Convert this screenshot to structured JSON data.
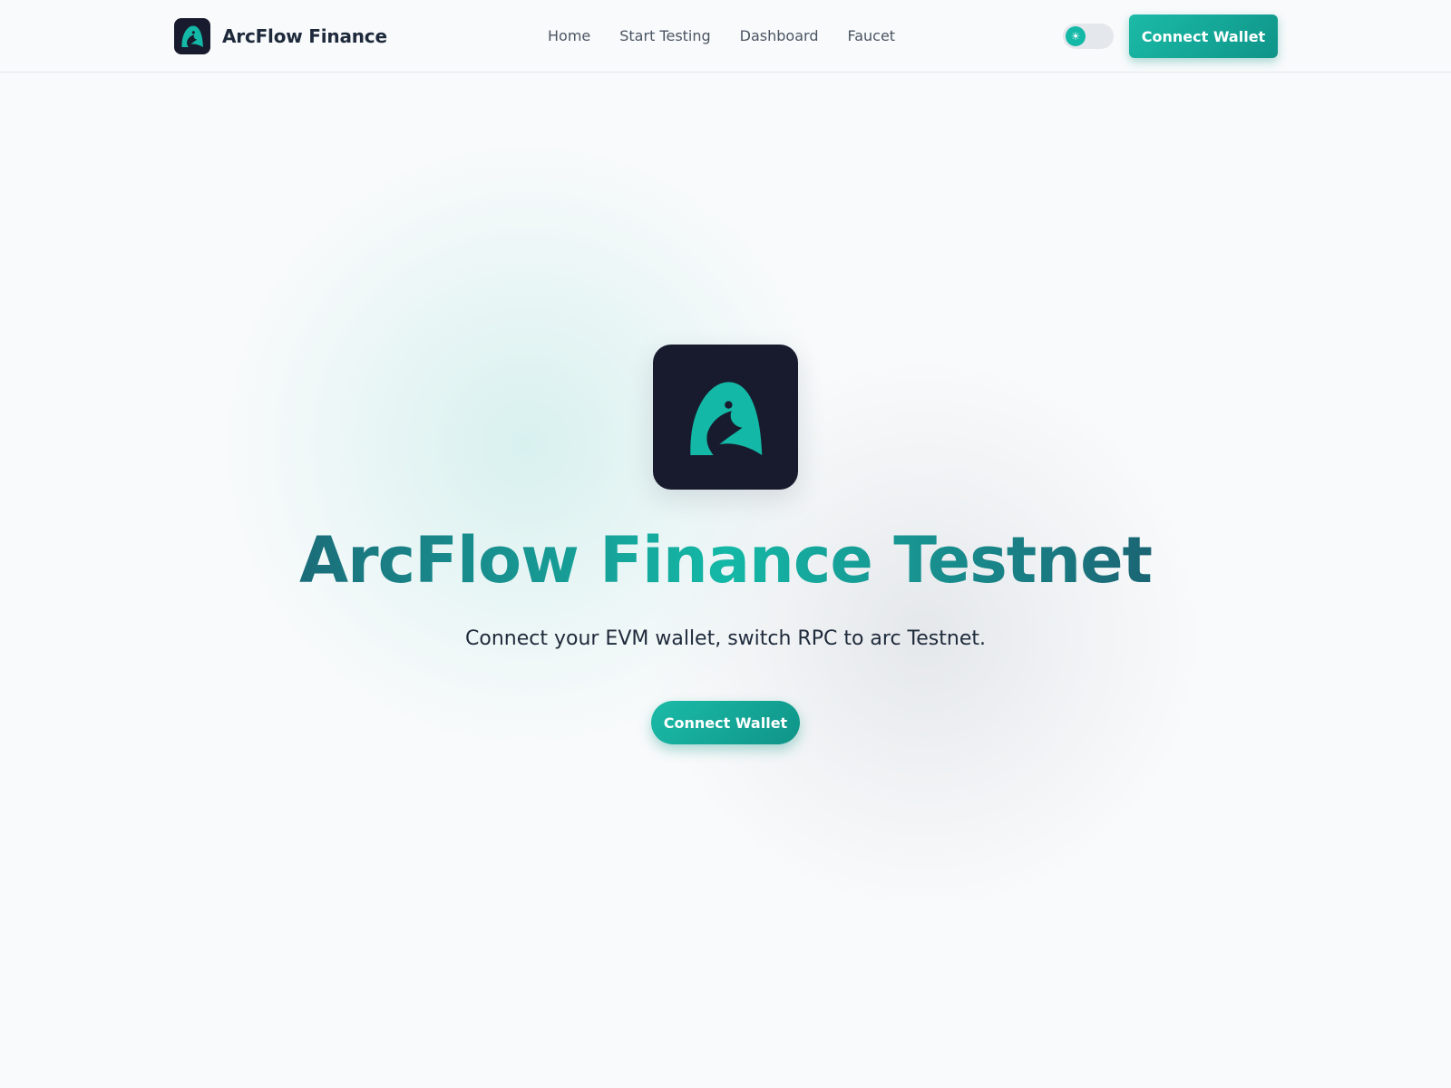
{
  "header": {
    "brand_name": "ArcFlow Finance",
    "nav": [
      {
        "label": "Home"
      },
      {
        "label": "Start Testing"
      },
      {
        "label": "Dashboard"
      },
      {
        "label": "Faucet"
      }
    ],
    "theme_toggle_icon": "sun-icon",
    "connect_label": "Connect Wallet"
  },
  "hero": {
    "title_parts": [
      "ArcFlow",
      "Finance",
      "Testnet"
    ],
    "subtitle": "Connect your EVM wallet, switch RPC to arc Testnet.",
    "cta_label": "Connect Wallet"
  },
  "colors": {
    "accent": "#14b8a6",
    "accent_dark": "#0f9488",
    "logo_bg": "#181b2e",
    "text_dark": "#1e2a3b",
    "background": "#f8fafb"
  },
  "icons": {
    "logo": "arcflow-logo-icon",
    "theme": "sun-icon"
  }
}
